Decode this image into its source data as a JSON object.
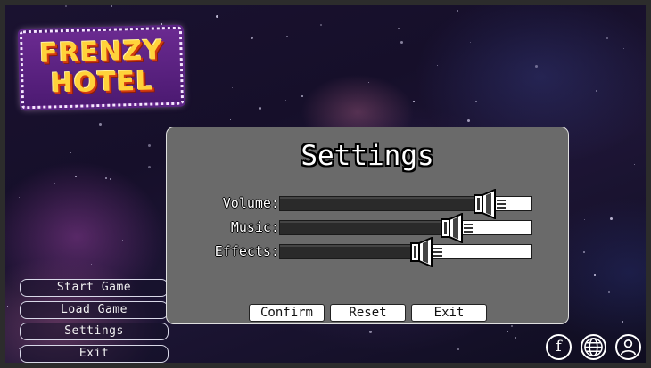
{
  "logo": {
    "line1": "FRENZY",
    "line2": "HOTEL"
  },
  "menu": {
    "items": [
      {
        "label": "Start Game"
      },
      {
        "label": "Load Game"
      },
      {
        "label": "Settings"
      },
      {
        "label": "Exit"
      }
    ]
  },
  "settings": {
    "title": "Settings",
    "sliders": [
      {
        "label": "Volume:",
        "level": 0.85
      },
      {
        "label": "Music:",
        "level": 0.72
      },
      {
        "label": "Effects:",
        "level": 0.6
      }
    ],
    "buttons": {
      "confirm": "Confirm",
      "reset": "Reset",
      "exit": "Exit"
    }
  },
  "social": {
    "icons": [
      "facebook-icon",
      "globe-icon",
      "user-profile-icon"
    ],
    "facebook_glyph": "f"
  },
  "colors": {
    "panel": "#6a6a6a",
    "logo_text": "#ffd23a",
    "logo_outline": "#d23a10",
    "slider_fill": "#2a2a2a",
    "slider_empty": "#ffffff"
  }
}
